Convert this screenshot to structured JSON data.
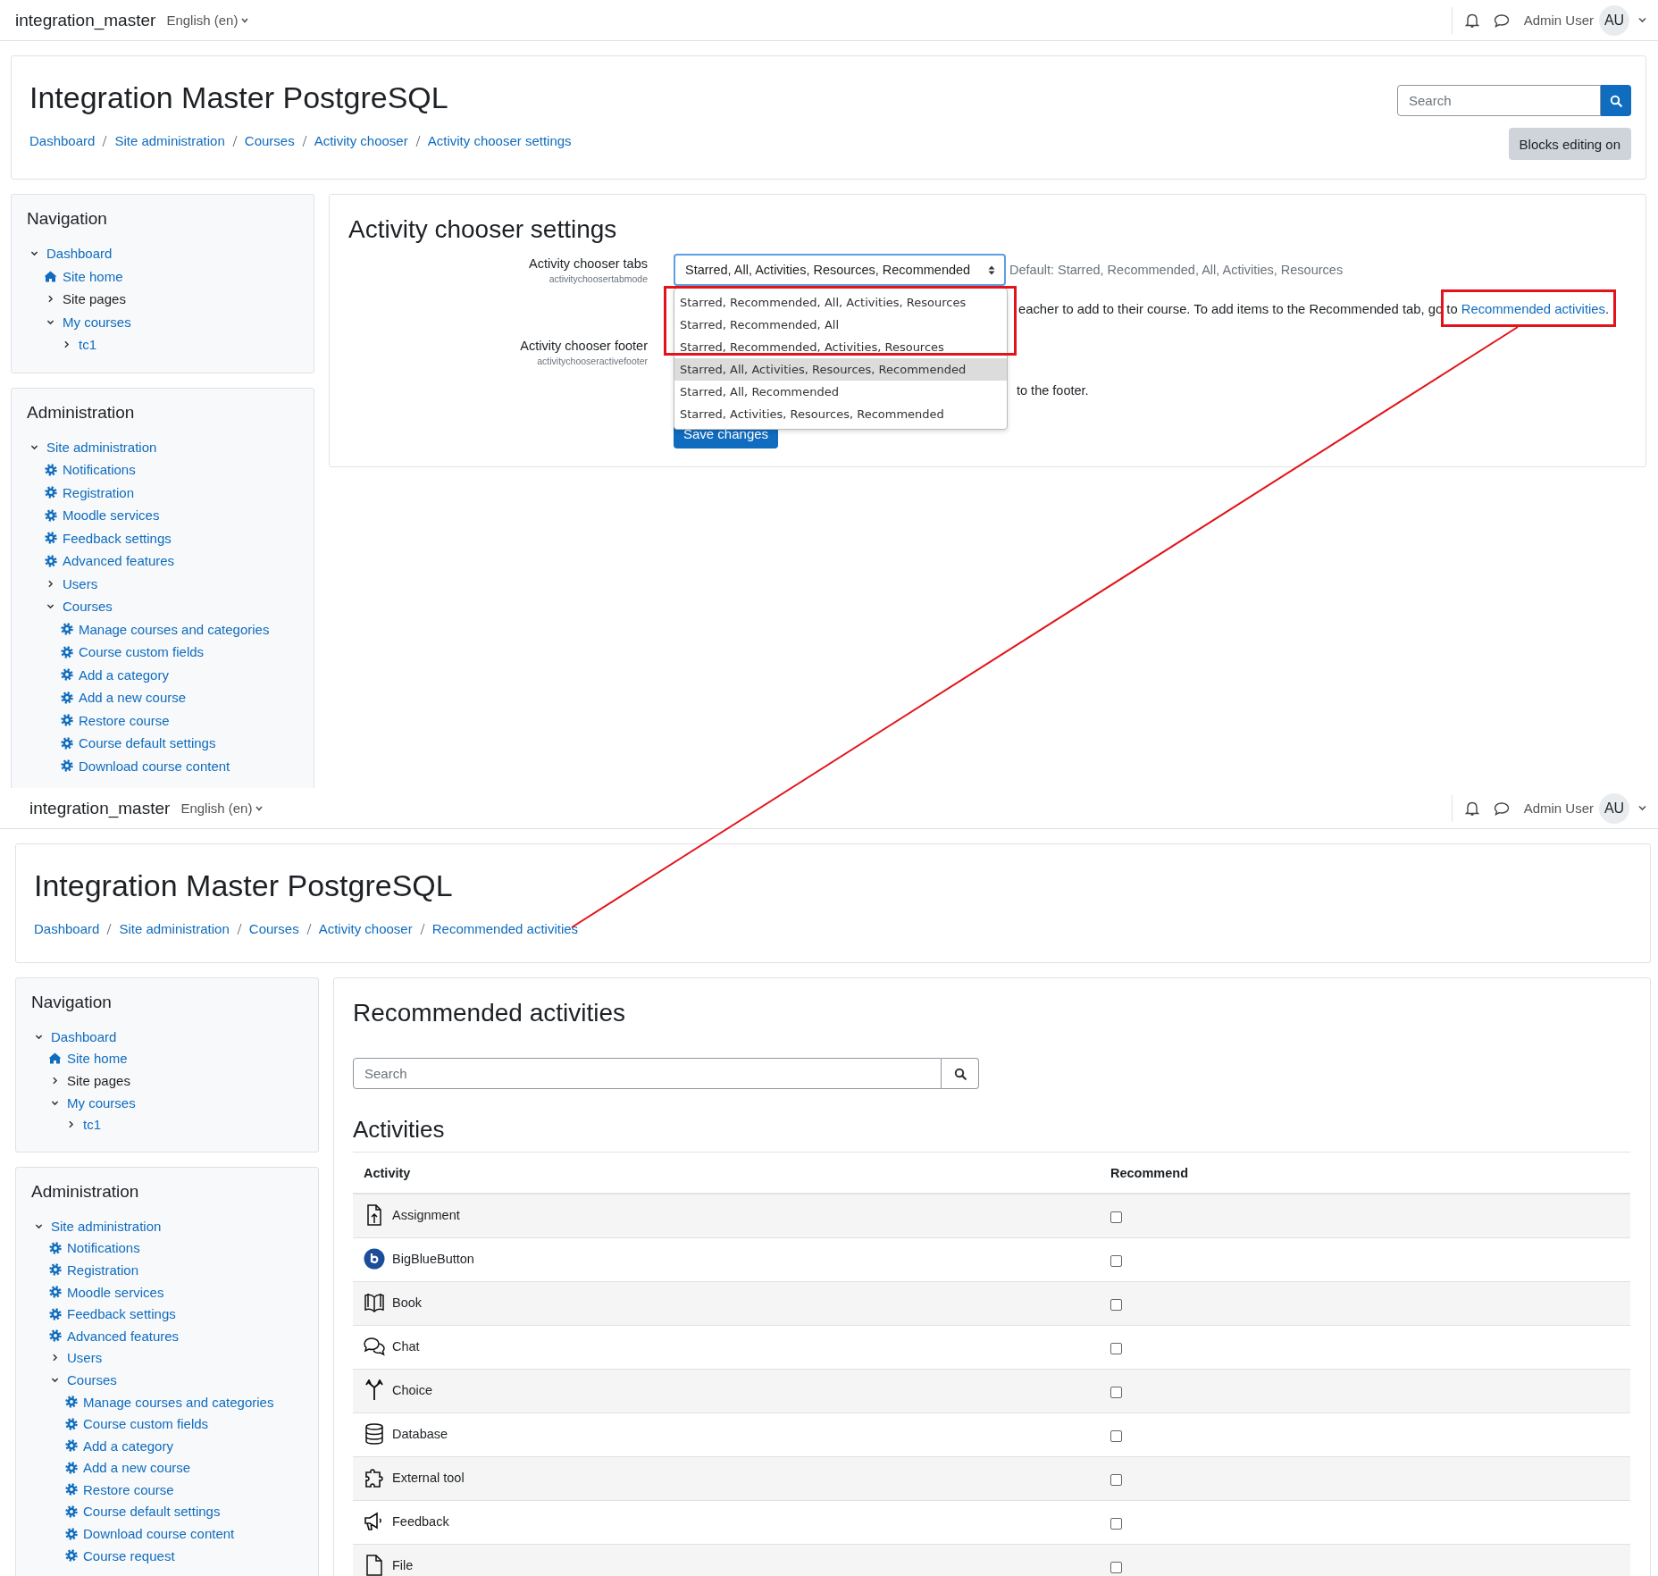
{
  "screens": [
    {
      "navbar": {
        "site_name": "integration_master",
        "language": "English (en)",
        "user_name": "Admin User",
        "avatar_initials": "AU"
      },
      "header": {
        "title": "Integration Master PostgreSQL",
        "breadcrumbs": [
          "Dashboard",
          "Site administration",
          "Courses",
          "Activity chooser",
          "Activity chooser settings"
        ],
        "search": {
          "placeholder": "Search"
        },
        "button": "Blocks editing on"
      },
      "navigation": {
        "title": "Navigation",
        "items": [
          {
            "label": "Dashboard",
            "kind": "branch",
            "link": true,
            "expanded": true,
            "children": [
              {
                "label": "Site home",
                "kind": "page",
                "link": true
              },
              {
                "label": "Site pages",
                "kind": "branch",
                "link": false,
                "expanded": false
              },
              {
                "label": "My courses",
                "kind": "branch",
                "link": true,
                "expanded": true,
                "children": [
                  {
                    "label": "tc1",
                    "kind": "branch",
                    "link": true,
                    "expanded": false
                  }
                ]
              }
            ]
          }
        ]
      },
      "administration": {
        "title": "Administration",
        "items": [
          {
            "label": "Site administration",
            "kind": "branch",
            "link": true,
            "expanded": true,
            "children": [
              {
                "label": "Notifications",
                "kind": "setting",
                "link": true
              },
              {
                "label": "Registration",
                "kind": "setting",
                "link": true
              },
              {
                "label": "Moodle services",
                "kind": "setting",
                "link": true
              },
              {
                "label": "Feedback settings",
                "kind": "setting",
                "link": true
              },
              {
                "label": "Advanced features",
                "kind": "setting",
                "link": true
              },
              {
                "label": "Users",
                "kind": "branch",
                "link": true,
                "expanded": false
              },
              {
                "label": "Courses",
                "kind": "branch",
                "link": true,
                "expanded": true,
                "children": [
                  {
                    "label": "Manage courses and categories",
                    "kind": "setting",
                    "link": true
                  },
                  {
                    "label": "Course custom fields",
                    "kind": "setting",
                    "link": true
                  },
                  {
                    "label": "Add a category",
                    "kind": "setting",
                    "link": true
                  },
                  {
                    "label": "Add a new course",
                    "kind": "setting",
                    "link": true
                  },
                  {
                    "label": "Restore course",
                    "kind": "setting",
                    "link": true
                  },
                  {
                    "label": "Course default settings",
                    "kind": "setting",
                    "link": true
                  },
                  {
                    "label": "Download course content",
                    "kind": "setting",
                    "link": true
                  }
                ]
              }
            ]
          }
        ]
      },
      "main": {
        "kind": "settings",
        "heading": "Activity chooser settings",
        "settings": [
          {
            "label": "Activity chooser tabs",
            "setting_name": "activitychoosertabmode",
            "value": "Starred, All, Activities, Resources, Recommended",
            "default": "Default: Starred, Recommended, All, Activities, Resources",
            "description": "eacher to add to their course. To add items to the Recommended tab, go to",
            "link": "Recommended activities",
            "after_link": "."
          },
          {
            "label": "Activity chooser footer",
            "setting_name": "activitychooseractivefooter",
            "description": "to the footer."
          }
        ],
        "dropdown": [
          {
            "label": "Starred, Recommended, All, Activities, Resources",
            "selected": false
          },
          {
            "label": "Starred, Recommended, All",
            "selected": false
          },
          {
            "label": "Starred, Recommended, Activities, Resources",
            "selected": false
          },
          {
            "label": "Starred, All, Activities, Resources, Recommended",
            "selected": true
          },
          {
            "label": "Starred, All, Recommended",
            "selected": false
          },
          {
            "label": "Starred, Activities, Resources, Recommended",
            "selected": false
          }
        ],
        "save_button": "Save changes"
      }
    },
    {
      "navbar": {
        "site_name": "integration_master",
        "language": "English (en)",
        "user_name": "Admin User",
        "avatar_initials": "AU"
      },
      "header": {
        "title": "Integration Master PostgreSQL",
        "breadcrumbs": [
          "Dashboard",
          "Site administration",
          "Courses",
          "Activity chooser",
          "Recommended activities"
        ]
      },
      "navigation": {
        "title": "Navigation",
        "items": [
          {
            "label": "Dashboard",
            "kind": "branch",
            "link": true,
            "expanded": true,
            "children": [
              {
                "label": "Site home",
                "kind": "page",
                "link": true
              },
              {
                "label": "Site pages",
                "kind": "branch",
                "link": false,
                "expanded": false
              },
              {
                "label": "My courses",
                "kind": "branch",
                "link": true,
                "expanded": true,
                "children": [
                  {
                    "label": "tc1",
                    "kind": "branch",
                    "link": true,
                    "expanded": false
                  }
                ]
              }
            ]
          }
        ]
      },
      "administration": {
        "title": "Administration",
        "items": [
          {
            "label": "Site administration",
            "kind": "branch",
            "link": true,
            "expanded": true,
            "children": [
              {
                "label": "Notifications",
                "kind": "setting",
                "link": true
              },
              {
                "label": "Registration",
                "kind": "setting",
                "link": true
              },
              {
                "label": "Moodle services",
                "kind": "setting",
                "link": true
              },
              {
                "label": "Feedback settings",
                "kind": "setting",
                "link": true
              },
              {
                "label": "Advanced features",
                "kind": "setting",
                "link": true
              },
              {
                "label": "Users",
                "kind": "branch",
                "link": true,
                "expanded": false
              },
              {
                "label": "Courses",
                "kind": "branch",
                "link": true,
                "expanded": true,
                "children": [
                  {
                    "label": "Manage courses and categories",
                    "kind": "setting",
                    "link": true
                  },
                  {
                    "label": "Course custom fields",
                    "kind": "setting",
                    "link": true
                  },
                  {
                    "label": "Add a category",
                    "kind": "setting",
                    "link": true
                  },
                  {
                    "label": "Add a new course",
                    "kind": "setting",
                    "link": true
                  },
                  {
                    "label": "Restore course",
                    "kind": "setting",
                    "link": true
                  },
                  {
                    "label": "Course default settings",
                    "kind": "setting",
                    "link": true
                  },
                  {
                    "label": "Download course content",
                    "kind": "setting",
                    "link": true
                  },
                  {
                    "label": "Course request",
                    "kind": "setting",
                    "link": true
                  }
                ]
              }
            ]
          }
        ]
      },
      "main": {
        "kind": "recommended",
        "heading": "Recommended activities",
        "search": {
          "placeholder": "Search"
        },
        "section": "Activities",
        "columns": [
          "Activity",
          "Recommend"
        ],
        "rows": [
          {
            "name": "Assignment",
            "kind": "assignment",
            "checked": false
          },
          {
            "name": "BigBlueButton",
            "kind": "conference",
            "checked": false
          },
          {
            "name": "Book",
            "kind": "book",
            "checked": false
          },
          {
            "name": "Chat",
            "kind": "chat",
            "checked": false
          },
          {
            "name": "Choice",
            "kind": "choice",
            "checked": false
          },
          {
            "name": "Database",
            "kind": "database",
            "checked": false
          },
          {
            "name": "External tool",
            "kind": "tool",
            "checked": false
          },
          {
            "name": "Feedback",
            "kind": "feedback",
            "checked": false
          },
          {
            "name": "File",
            "kind": "file",
            "checked": false
          }
        ]
      }
    }
  ],
  "annotations": [
    {
      "kind": "box"
    },
    {
      "kind": "box"
    },
    {
      "kind": "line"
    }
  ]
}
